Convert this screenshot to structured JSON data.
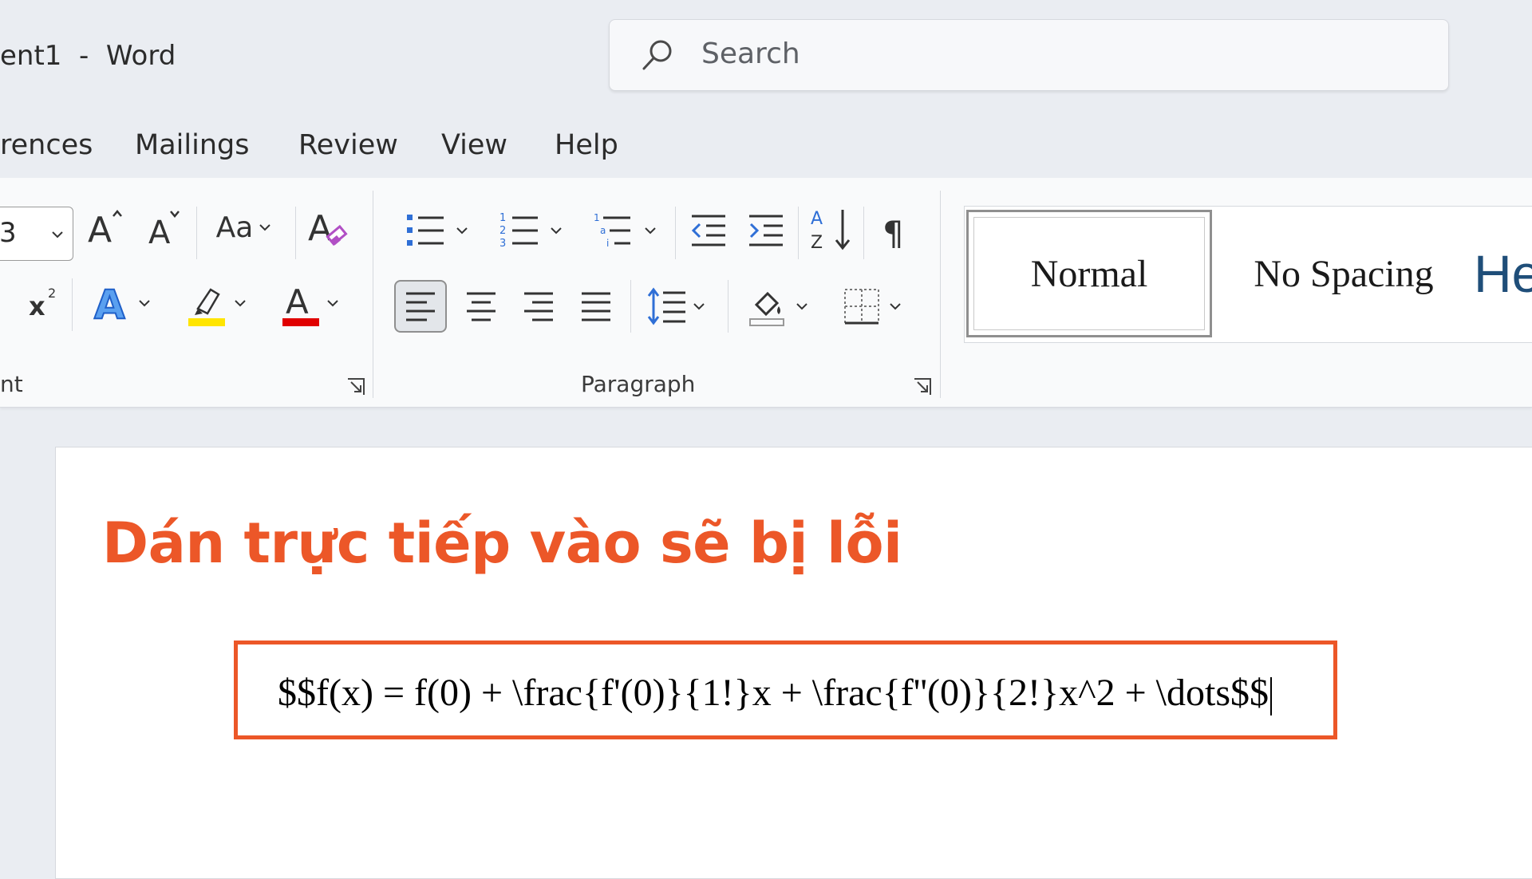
{
  "window": {
    "document_title": "ent1  -  Word"
  },
  "search": {
    "placeholder": "Search"
  },
  "tabs": [
    {
      "label": "rences"
    },
    {
      "label": "Mailings"
    },
    {
      "label": "Review"
    },
    {
      "label": "View"
    },
    {
      "label": "Help"
    }
  ],
  "ribbon": {
    "font_group": {
      "label": "nt",
      "font_size_value": "3",
      "change_case_label": "Aa",
      "highlight_color": "#ffe500",
      "font_color": "#e00000"
    },
    "paragraph_group": {
      "label": "Paragraph"
    },
    "styles": [
      {
        "label": "Normal"
      },
      {
        "label": "No Spacing"
      },
      {
        "label": "He"
      }
    ]
  },
  "document": {
    "annotation": "Dán trực tiếp vào sẽ bị lỗi",
    "formula": "$$f(x) = f(0) + \\frac{f'(0)}{1!}x + \\frac{f''(0)}{2!}x^2 + \\dots$$"
  },
  "colors": {
    "accent": "#ec5728",
    "heading_style": "#1f4e79",
    "text_effects": "#2f6fd6"
  }
}
